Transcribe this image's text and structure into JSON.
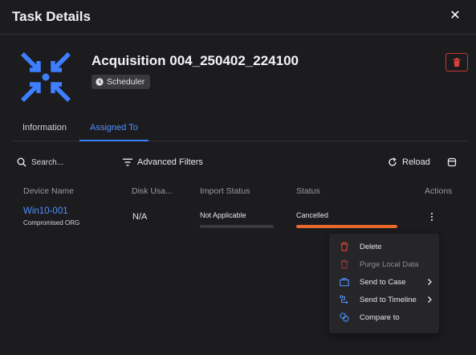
{
  "header": {
    "title": "Task Details",
    "close_symbol": "✕"
  },
  "task": {
    "title": "Acquisition 004_250402_224100",
    "type_badge": "Scheduler",
    "icon": "acquisition-arrows-icon",
    "accent_color": "#3d7fff"
  },
  "tabs": [
    {
      "label": "Information",
      "active": false
    },
    {
      "label": "Assigned To",
      "active": true
    }
  ],
  "toolbar": {
    "search_placeholder": "Search...",
    "filters_label": "Advanced Filters",
    "reload_label": "Reload"
  },
  "table": {
    "columns": [
      "Device Name",
      "Disk Usa...",
      "Import Status",
      "Status",
      "Actions"
    ],
    "rows": [
      {
        "device_name": "Win10-001",
        "organization": "Compromised ORG",
        "disk_usage": "N/A",
        "import_status": "Not Applicable",
        "import_progress": 0,
        "status": "Cancelled",
        "status_progress": 1,
        "status_color": "#e8682c"
      }
    ]
  },
  "context_menu": {
    "items": [
      {
        "label": "Delete",
        "icon": "trash-icon",
        "disabled": false,
        "submenu": false
      },
      {
        "label": "Purge Local Data",
        "icon": "trash-icon",
        "disabled": true,
        "submenu": false
      },
      {
        "label": "Send to Case",
        "icon": "briefcase-icon",
        "disabled": false,
        "submenu": true
      },
      {
        "label": "Send to Timeline",
        "icon": "timeline-icon",
        "disabled": false,
        "submenu": true
      },
      {
        "label": "Compare to",
        "icon": "compare-icon",
        "disabled": false,
        "submenu": false
      }
    ]
  },
  "colors": {
    "danger": "#d8433a",
    "link": "#4c8fff",
    "status_cancelled": "#e8682c"
  }
}
